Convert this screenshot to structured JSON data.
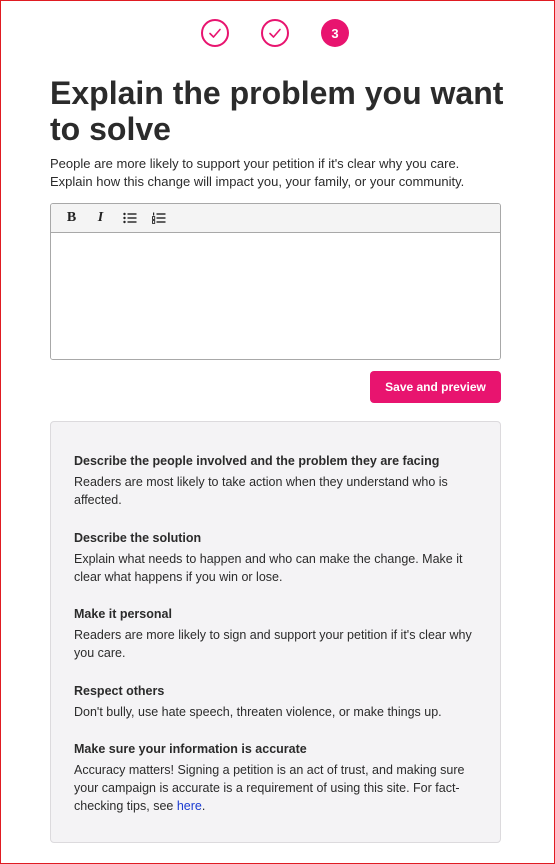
{
  "stepper": {
    "steps": [
      {
        "state": "done"
      },
      {
        "state": "done"
      },
      {
        "state": "current",
        "label": "3"
      }
    ]
  },
  "heading": "Explain the problem you want to solve",
  "intro": "People are more likely to support your petition if it's clear why you care. Explain how this change will impact you, your family, or your community.",
  "editor": {
    "toolbar": [
      "bold-icon",
      "italic-icon",
      "bulleted-list-icon",
      "numbered-list-icon"
    ],
    "bold_glyph": "B",
    "italic_glyph": "I",
    "value": ""
  },
  "save_label": "Save and preview",
  "tips": [
    {
      "title": "Describe the people involved and the problem they are facing",
      "body": "Readers are most likely to take action when they understand who is affected."
    },
    {
      "title": "Describe the solution",
      "body": "Explain what needs to happen and who can make the change. Make it clear what happens if you win or lose."
    },
    {
      "title": "Make it personal",
      "body": "Readers are more likely to sign and support your petition if it's clear why you care."
    },
    {
      "title": "Respect others",
      "body": "Don't bully, use hate speech, threaten violence, or make things up."
    },
    {
      "title": "Make sure your information is accurate",
      "body": "Accuracy matters! Signing a petition is an act of trust, and making sure your campaign is accurate is a requirement of using this site. For fact-checking tips, see ",
      "link": "here",
      "suffix": "."
    }
  ],
  "colors": {
    "accent": "#e8146f",
    "link": "#1a3bd1",
    "panel": "#f4f3f5"
  }
}
